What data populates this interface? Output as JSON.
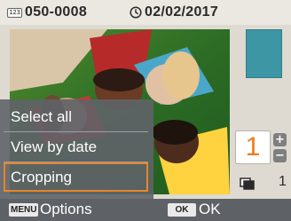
{
  "header": {
    "file_icon_text": "123",
    "file_number": "050-0008",
    "date": "02/02/2017"
  },
  "options_menu": {
    "items": [
      {
        "label": "Select all"
      },
      {
        "label": "View by date"
      },
      {
        "label": "Cropping",
        "selected": true
      }
    ],
    "highlight_color": "#e8862a"
  },
  "print_settings": {
    "quantity": "1",
    "copies": "1",
    "preview_color": "#3d96a4"
  },
  "footer": {
    "menu_key": "MENU",
    "menu_label": "Options",
    "ok_key": "OK",
    "ok_label": "OK"
  },
  "icons": [
    "file-number-icon",
    "clock-icon",
    "plus-icon",
    "minus-icon",
    "copies-icon"
  ]
}
